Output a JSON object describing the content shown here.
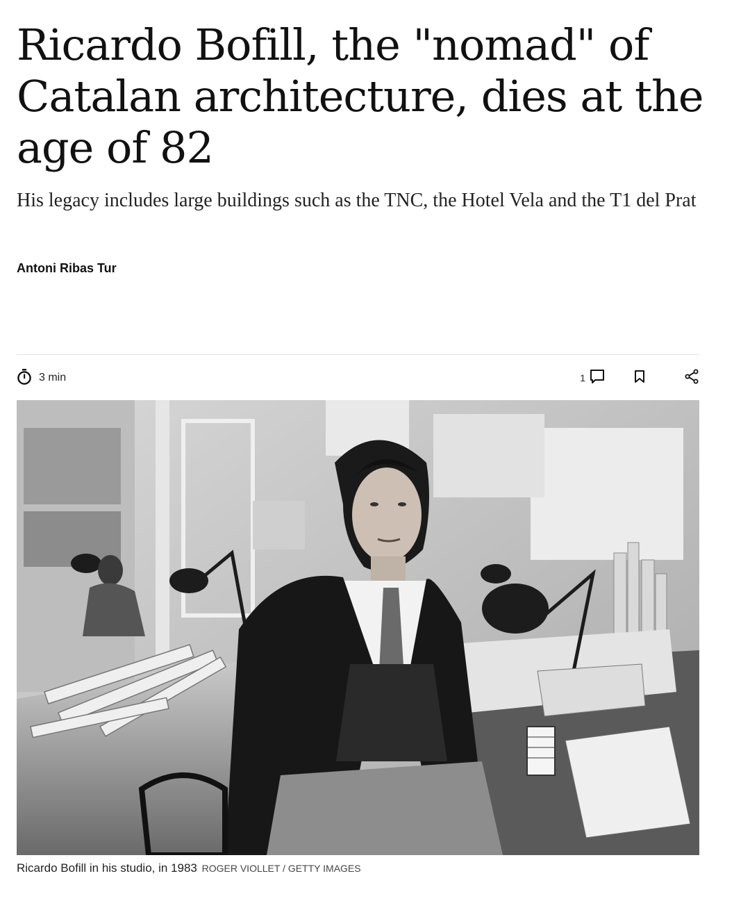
{
  "article": {
    "headline": "Ricardo Bofill, the \"nomad\" of Catalan architecture, dies at the age of 82",
    "subtitle": "His legacy includes large buildings such as the TNC, the Hotel Vela and the T1 del Prat",
    "byline": "Antoni Ribas Tur"
  },
  "toolbar": {
    "read_time": "3 min",
    "comment_count": "1",
    "icons": {
      "timer": "stopwatch-icon",
      "comments": "comment-icon",
      "bookmark": "bookmark-icon",
      "share": "share-icon"
    }
  },
  "figure": {
    "caption": "Ricardo Bofill in his studio, in 1983",
    "credit": "ROGER VIOLLET / GETTY IMAGES"
  }
}
